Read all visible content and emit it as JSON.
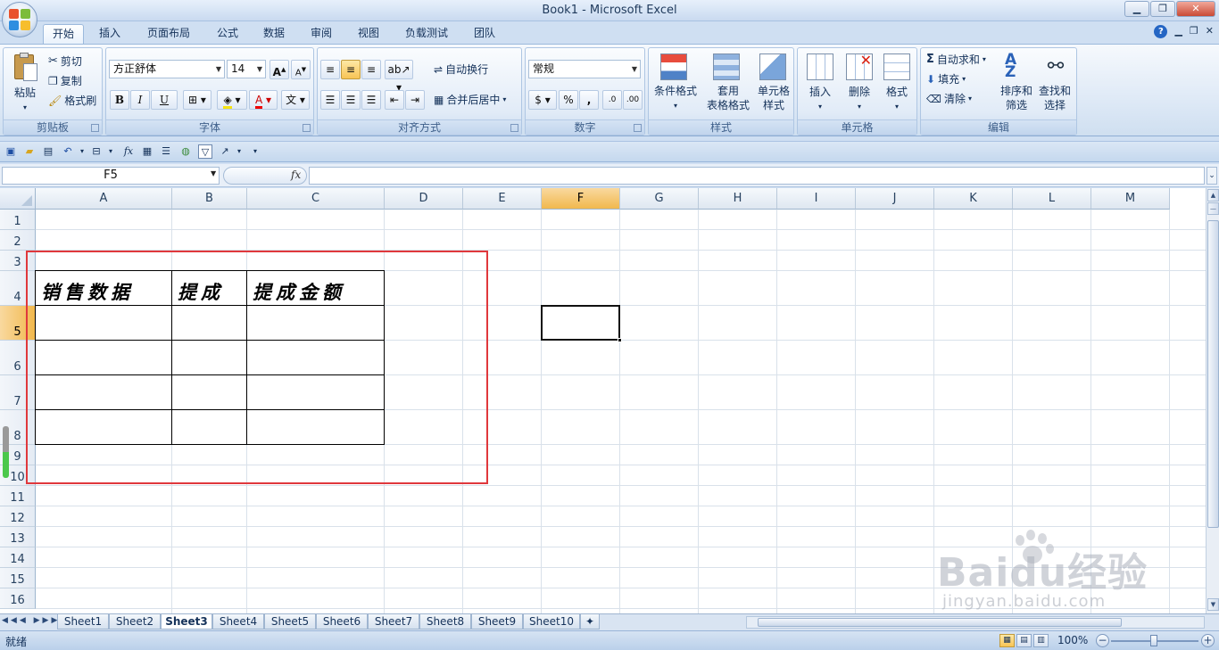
{
  "window": {
    "title": "Book1 - Microsoft Excel"
  },
  "tabs": [
    "开始",
    "插入",
    "页面布局",
    "公式",
    "数据",
    "审阅",
    "视图",
    "负载测试",
    "团队"
  ],
  "ribbon": {
    "clipboard": {
      "label": "剪贴板",
      "paste": "粘贴",
      "cut": "剪切",
      "copy": "复制",
      "format_painter": "格式刷"
    },
    "font": {
      "label": "字体",
      "font_name": "方正舒体",
      "font_size": "14",
      "grow": "A",
      "shrink": "A",
      "bold": "B",
      "italic": "I",
      "underline": "U",
      "font_color_letter": "A",
      "phonetic": "文"
    },
    "alignment": {
      "label": "对齐方式",
      "wrap_text": "自动换行",
      "merge_center": "合并后居中"
    },
    "number": {
      "label": "数字",
      "format": "常规",
      "percent": "%",
      "comma": ",",
      "inc_decimal": ".0",
      "dec_decimal": ".00"
    },
    "styles": {
      "label": "样式",
      "conditional": "条件格式",
      "table_line1": "套用",
      "table_line2": "表格格式",
      "cell_line1": "单元格",
      "cell_line2": "样式"
    },
    "cells": {
      "label": "单元格",
      "insert": "插入",
      "delete": "删除",
      "format": "格式"
    },
    "editing": {
      "label": "编辑",
      "autosum": "自动求和",
      "fill": "填充",
      "clear": "清除",
      "sort_line1": "排序和",
      "sort_line2": "筛选",
      "find_line1": "查找和",
      "find_line2": "选择"
    }
  },
  "formula_bar": {
    "name_box": "F5",
    "fx": "fx",
    "value": ""
  },
  "columns": [
    "A",
    "B",
    "C",
    "D",
    "E",
    "F",
    "G",
    "H",
    "I",
    "J",
    "K",
    "L",
    "M"
  ],
  "rows": [
    "1",
    "2",
    "3",
    "4",
    "5",
    "6",
    "7",
    "8",
    "9",
    "10",
    "11",
    "12",
    "13",
    "14",
    "15",
    "16"
  ],
  "selected": {
    "column": "F",
    "row": "5"
  },
  "cells": {
    "A4": "销售数据",
    "B4": "提成",
    "C4": "提成金额"
  },
  "sheets": [
    "Sheet1",
    "Sheet2",
    "Sheet3",
    "Sheet4",
    "Sheet5",
    "Sheet6",
    "Sheet7",
    "Sheet8",
    "Sheet9",
    "Sheet10"
  ],
  "active_sheet": "Sheet3",
  "status": {
    "ready": "就绪",
    "zoom": "100%",
    "zoom_minus": "−",
    "zoom_plus": "+"
  },
  "watermark": {
    "main": "Baidu经验",
    "sub": "jingyan.baidu.com"
  },
  "colors": {
    "accent": "#e0383c",
    "selected_header": "#f1b84d",
    "ribbon": "#dbe7f5"
  }
}
